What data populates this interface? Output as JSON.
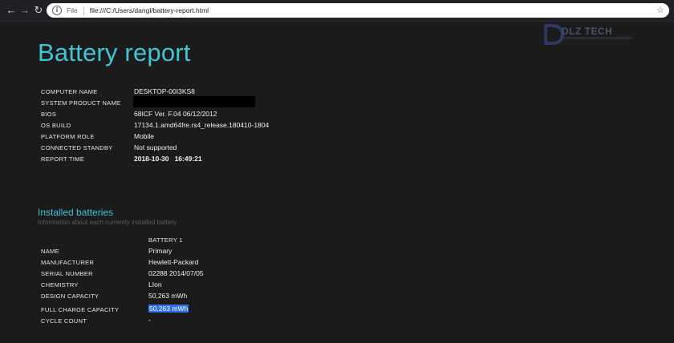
{
  "browser": {
    "scheme": "File",
    "url": "file:///C:/Users/dangl/battery-report.html"
  },
  "watermark": {
    "text": "DLZ TECH"
  },
  "report": {
    "title": "Battery report",
    "system_info": [
      {
        "label": "COMPUTER NAME",
        "value": "DESKTOP-00I3KS8"
      },
      {
        "label": "SYSTEM PRODUCT NAME",
        "value": ""
      },
      {
        "label": "BIOS",
        "value": "68ICF Ver. F.04 06/12/2012"
      },
      {
        "label": "OS BUILD",
        "value": "17134.1.amd64fre.rs4_release.180410-1804"
      },
      {
        "label": "PLATFORM ROLE",
        "value": "Mobile"
      },
      {
        "label": "CONNECTED STANDBY",
        "value": "Not supported"
      },
      {
        "label": "REPORT TIME",
        "value": "2018-10-30   16:49:21"
      }
    ]
  },
  "installed_batteries": {
    "title": "Installed batteries",
    "subtitle": "Information about each currently installed battery",
    "column_header": "BATTERY 1",
    "rows": [
      {
        "label": "NAME",
        "value": "Primary"
      },
      {
        "label": "MANUFACTURER",
        "value": "Hewlett-Packard"
      },
      {
        "label": "SERIAL NUMBER",
        "value": "02288 2014/07/05"
      },
      {
        "label": "CHEMISTRY",
        "value": "LIon"
      },
      {
        "label": "DESIGN CAPACITY",
        "value": "50,263 mWh"
      },
      {
        "label": "FULL CHARGE CAPACITY",
        "value": "50,263 mWh"
      },
      {
        "label": "CYCLE COUNT",
        "value": "-"
      }
    ]
  },
  "colors": {
    "accent": "#3fc5d6",
    "background": "#1b1b1b",
    "selection": "#2e6ee6"
  }
}
